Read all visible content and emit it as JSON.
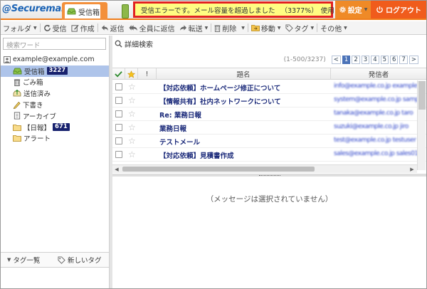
{
  "app": {
    "logo": "@Securemail",
    "tab_inbox": "受信箱",
    "alert": {
      "message": "受信エラーです。メール容量を超過しました",
      "percent": "（3377%）",
      "used": "使用"
    },
    "settings_label": "設定",
    "logout_label": "ログアウト",
    "colors": {
      "accent": "#f07d1a",
      "alert_border": "#e12121",
      "alert_bg": "#fffd82",
      "selected": "#aec4ea",
      "badge": "#17216e"
    }
  },
  "toolbar": {
    "folder": "フォルダ",
    "receive": "受信",
    "compose": "作成",
    "reply": "返信",
    "reply_all": "全員に返信",
    "forward": "転送",
    "delete": "削除",
    "move": "移動",
    "tag": "タグ",
    "more": "その他"
  },
  "sidebar": {
    "search_placeholder": "検索ワード",
    "account": "example@example.com",
    "folders": [
      {
        "label": "受信箱",
        "badge": "3227",
        "icon": "inbox-icon"
      },
      {
        "label": "ごみ箱",
        "icon": "trash-icon"
      },
      {
        "label": "送信済み",
        "icon": "sent-icon"
      },
      {
        "label": "下書き",
        "icon": "draft-icon"
      },
      {
        "label": "アーカイブ",
        "icon": "archive-icon"
      },
      {
        "label": "【日報】",
        "badge": "671",
        "icon": "folder-icon"
      },
      {
        "label": "アラート",
        "icon": "folder-icon"
      }
    ],
    "tag_list": "タグ一覧",
    "new_tag": "新しいタグ"
  },
  "main": {
    "advanced_search": "詳細検索",
    "pager": {
      "range": "(1-500/3237)",
      "prev": "<",
      "pages": [
        "1",
        "2",
        "3",
        "4",
        "5",
        "6",
        "7"
      ],
      "next": ">",
      "current": "1"
    },
    "columns": {
      "flag": "!",
      "subject": "題名",
      "sender": "発信者"
    },
    "messages": [
      {
        "subject": "【対応依頼】ホームページ修正について",
        "sender": "info@example.co.jp example"
      },
      {
        "subject": "【情報共有】社内ネットワークについて",
        "sender": "system@example.co.jp sample"
      },
      {
        "subject": "Re: 業務日報",
        "sender": "tanaka@example.co.jp taro"
      },
      {
        "subject": "業務日報",
        "sender": "suzuki@example.co.jp jiro"
      },
      {
        "subject": "テストメール",
        "sender": "test@example.co.jp testuser"
      },
      {
        "subject": "【対応依頼】見積書作成",
        "sender": "sales@example.co.jp sales01"
      }
    ],
    "empty_preview": "（メッセージは選択されていません）"
  }
}
